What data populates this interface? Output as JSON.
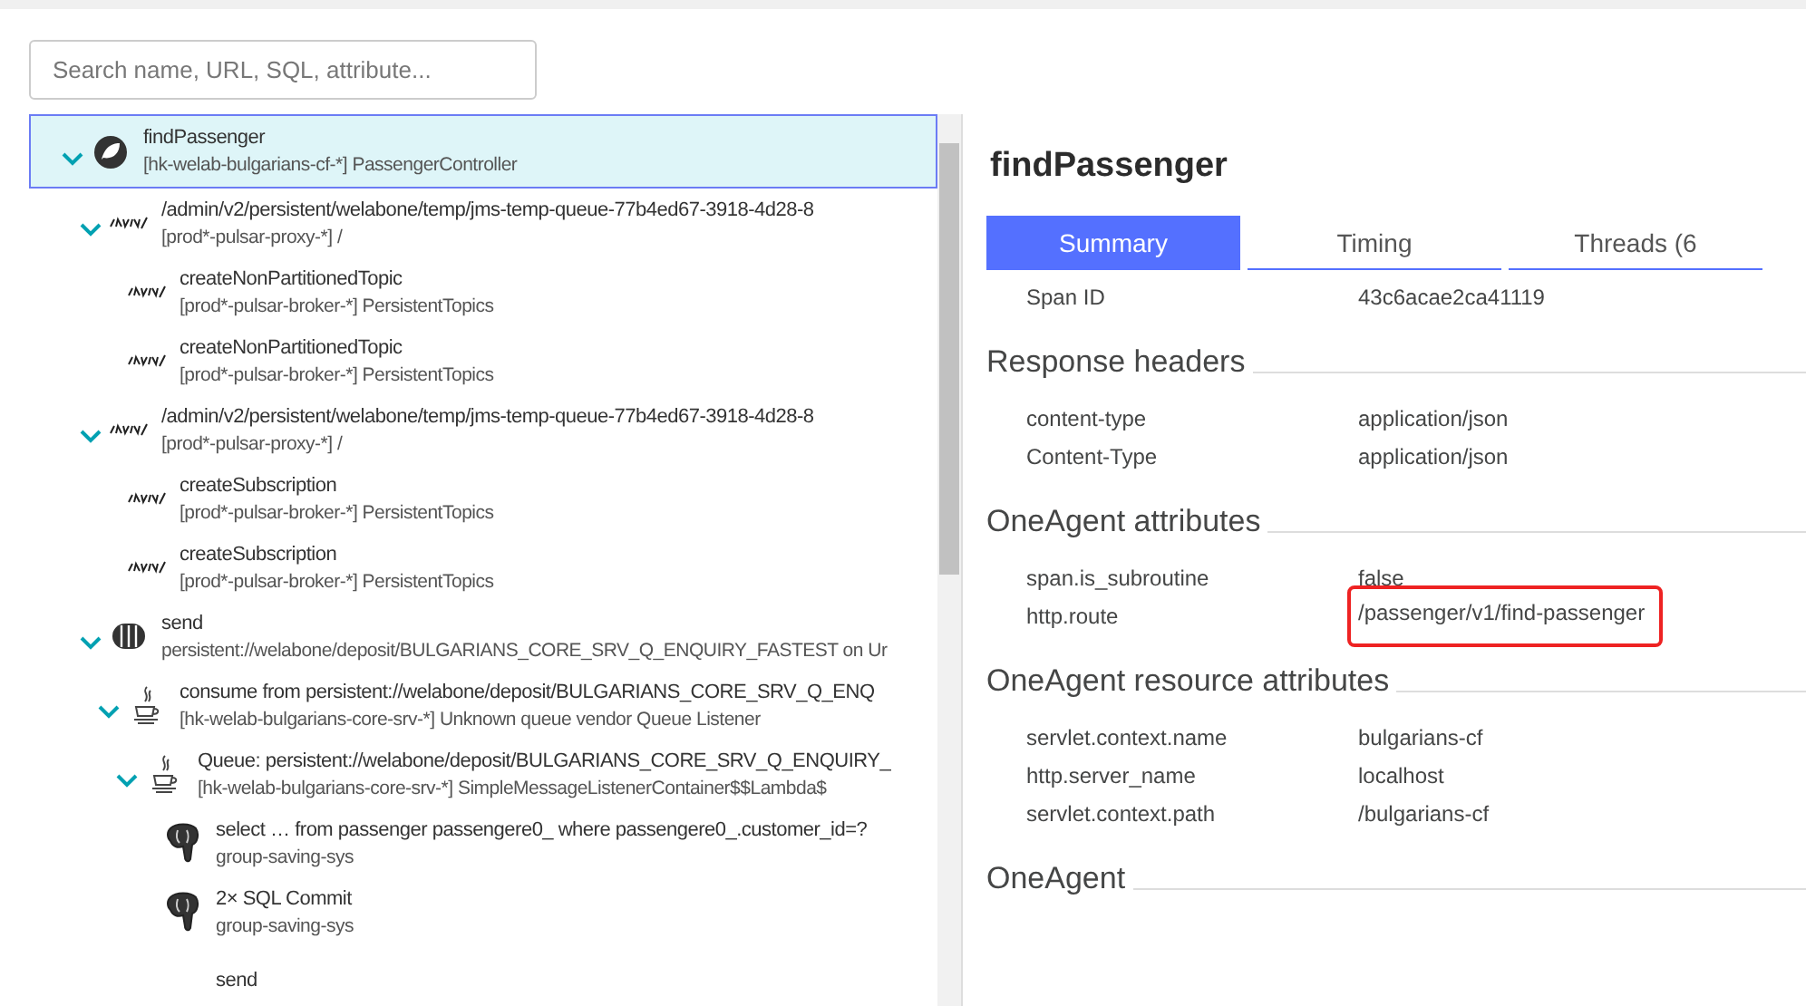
{
  "search": {
    "placeholder": "Search name, URL, SQL, attribute..."
  },
  "tree": [
    {
      "kind": "spring",
      "title": "findPassenger",
      "subtitle": "[hk-welab-bulgarians-cf-*] PassengerController",
      "selected": true,
      "expanded": true,
      "children": [
        {
          "kind": "jetty",
          "title": "/admin/v2/persistent/welabone/temp/jms-temp-queue-77b4ed67-3918-4d28-8",
          "subtitle": "[prod*-pulsar-proxy-*] /",
          "selected": false,
          "expanded": true,
          "children": [
            {
              "kind": "jetty",
              "title": "createNonPartitionedTopic",
              "subtitle": "[prod*-pulsar-broker-*] PersistentTopics",
              "selected": false
            },
            {
              "kind": "jetty",
              "title": "createNonPartitionedTopic",
              "subtitle": "[prod*-pulsar-broker-*] PersistentTopics",
              "selected": false
            }
          ]
        },
        {
          "kind": "jetty",
          "title": "/admin/v2/persistent/welabone/temp/jms-temp-queue-77b4ed67-3918-4d28-8",
          "subtitle": "[prod*-pulsar-proxy-*] /",
          "selected": false,
          "expanded": true,
          "children": [
            {
              "kind": "jetty",
              "title": "createSubscription",
              "subtitle": "[prod*-pulsar-broker-*] PersistentTopics",
              "selected": false
            },
            {
              "kind": "jetty",
              "title": "createSubscription",
              "subtitle": "[prod*-pulsar-broker-*] PersistentTopics",
              "selected": false
            }
          ]
        },
        {
          "kind": "queue",
          "title": "send",
          "subtitle": "persistent://welabone/deposit/BULGARIANS_CORE_SRV_Q_ENQUIRY_FASTEST on Ur",
          "selected": false,
          "expanded": true,
          "children": [
            {
              "kind": "java",
              "title": "consume from persistent://welabone/deposit/BULGARIANS_CORE_SRV_Q_ENQ",
              "subtitle": "[hk-welab-bulgarians-core-srv-*] Unknown queue vendor Queue Listener",
              "selected": false,
              "expanded": true,
              "children": [
                {
                  "kind": "java",
                  "title": "Queue: persistent://welabone/deposit/BULGARIANS_CORE_SRV_Q_ENQUIRY_",
                  "subtitle": "[hk-welab-bulgarians-core-srv-*] SimpleMessageListenerContainer$$Lambda$",
                  "selected": false,
                  "expanded": true,
                  "children": [
                    {
                      "kind": "postgres",
                      "title": "select … from passenger passengere0_ where passengere0_.customer_id=?",
                      "subtitle": "group-saving-sys",
                      "selected": false
                    },
                    {
                      "kind": "postgres",
                      "title": "2× SQL Commit",
                      "subtitle": "group-saving-sys",
                      "selected": false
                    },
                    {
                      "kind": "none",
                      "title": "send",
                      "selected": false
                    }
                  ]
                }
              ]
            }
          ]
        }
      ]
    }
  ],
  "detail": {
    "title": "findPassenger",
    "tabs": [
      {
        "label": "Summary",
        "selected": true
      },
      {
        "label": "Timing",
        "selected": false
      },
      {
        "label": "Threads (6",
        "selected": false
      }
    ],
    "sections": [
      {
        "rows": [
          {
            "key": "Span ID",
            "value": "43c6acae2ca41119",
            "highlighted": false
          }
        ]
      },
      {
        "title": "Response headers",
        "rows": [
          {
            "key": "content-type",
            "value": "application/json",
            "highlighted": false
          },
          {
            "key": "Content-Type",
            "value": "application/json",
            "highlighted": false
          }
        ]
      },
      {
        "title": "OneAgent attributes",
        "rows": [
          {
            "key": "span.is_subroutine",
            "value": "false",
            "highlighted": false
          },
          {
            "key": "http.route",
            "value": "/passenger/v1/find-passenger",
            "highlighted": true
          }
        ]
      },
      {
        "title": "OneAgent resource attributes",
        "rows": [
          {
            "key": "servlet.context.name",
            "value": "bulgarians-cf",
            "highlighted": false
          },
          {
            "key": "http.server_name",
            "value": "localhost",
            "highlighted": false
          },
          {
            "key": "servlet.context.path",
            "value": "/bulgarians-cf",
            "highlighted": false
          }
        ]
      },
      {
        "title": "OneAgent"
      }
    ]
  }
}
